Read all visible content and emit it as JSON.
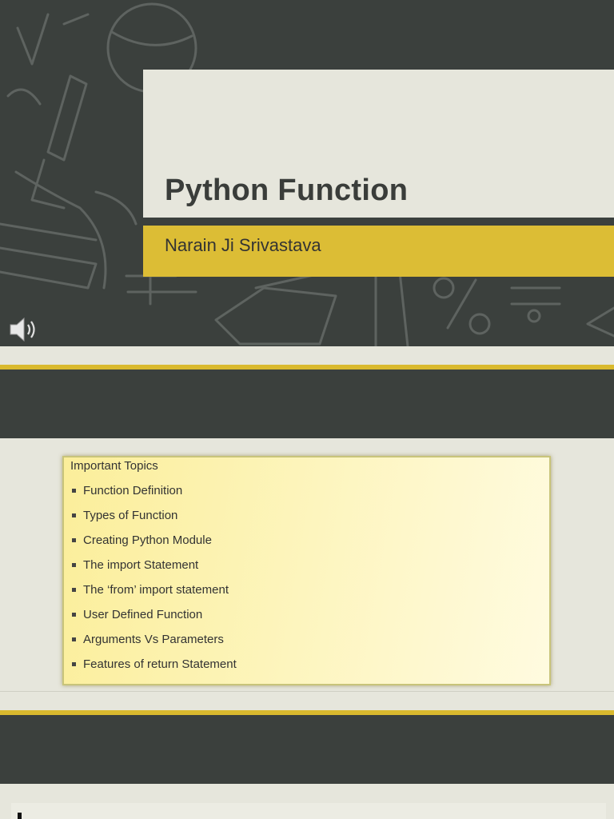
{
  "slide1": {
    "title": "Python Function",
    "subtitle": "Narain Ji Srivastava",
    "colors": {
      "background": "#3b403d",
      "title_panel": "#e6e6dc",
      "subtitle_band": "#dcbd35"
    }
  },
  "slide2": {
    "heading": "Important Topics",
    "topics": [
      "Function Definition",
      "Types of Function",
      "Creating  Python Module",
      "The import Statement",
      "The ‘from’ import statement",
      "User Defined Function",
      "Arguments Vs Parameters",
      "Features of return Statement"
    ],
    "colors": {
      "box": "#fdf5be",
      "divider": "#d9b92e"
    }
  },
  "icons": {
    "audio": "speaker-icon"
  }
}
